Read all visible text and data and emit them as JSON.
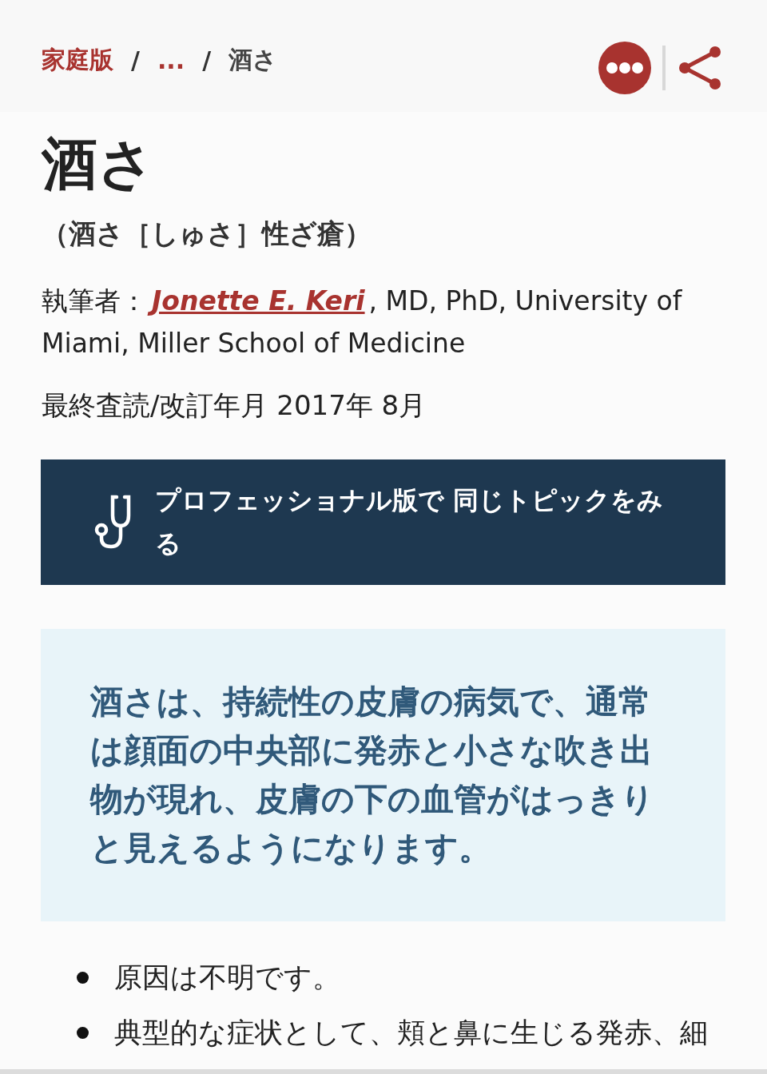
{
  "breadcrumb": [
    {
      "kind": "link",
      "label": "家庭版"
    },
    {
      "kind": "separator",
      "label": "/"
    },
    {
      "kind": "link",
      "label": "..."
    },
    {
      "kind": "separator",
      "label": "/"
    },
    {
      "kind": "current",
      "label": "酒さ"
    }
  ],
  "title": "酒さ",
  "subtitle": "（酒さ［しゅさ］性ざ瘡）",
  "author": {
    "label": "執筆者：",
    "name": "Jonette E. Keri",
    "affiliation": ", MD, PhD, University of Miami, Miller School of Medicine"
  },
  "review_date": "最終査読/改訂年月 2017年 8月",
  "professional_banner": {
    "label": "プロフェッショナル版で 同じトピックをみる"
  },
  "summary": "酒さは、持続性の皮膚の病気で、通常は顔面の中央部に発赤と小さな吹き出物が現れ、皮膚の下の血管がはっきりと見えるようになります。",
  "bullets": [
    "原因は不明です。",
    "典型的な症状として、頬と鼻に生じる発赤、細"
  ]
}
